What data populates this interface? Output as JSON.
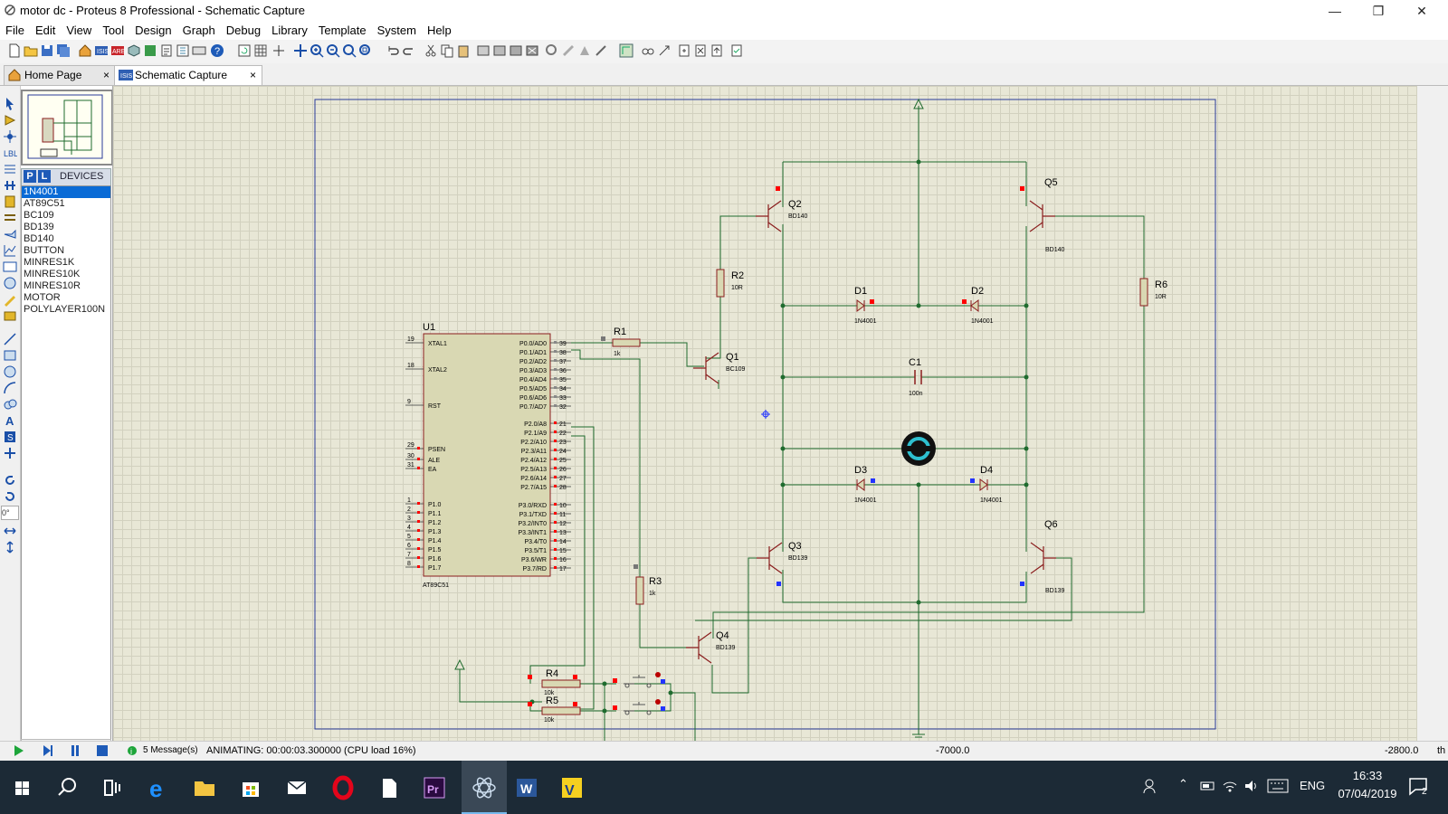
{
  "window": {
    "title": "motor dc - Proteus 8 Professional - Schematic Capture"
  },
  "menu": [
    "File",
    "Edit",
    "View",
    "Tool",
    "Design",
    "Graph",
    "Debug",
    "Library",
    "Template",
    "System",
    "Help"
  ],
  "tabs": [
    {
      "label": "Home Page",
      "close": "×"
    },
    {
      "label": "Schematic Capture",
      "close": "×"
    }
  ],
  "devices": {
    "header": "DEVICES",
    "p_button": "P",
    "l_button": "L",
    "items": [
      "1N4001",
      "AT89C51",
      "BC109",
      "BD139",
      "BD140",
      "BUTTON",
      "MINRES1K",
      "MINRES10K",
      "MINRES10R",
      "MOTOR",
      "POLYLAYER100N"
    ],
    "selected": "1N4001"
  },
  "rotation": "0°",
  "schematic": {
    "u1": {
      "ref": "U1",
      "part": "AT89C51",
      "left_pins": [
        {
          "num": "19",
          "name": "XTAL1"
        },
        {
          "num": "18",
          "name": "XTAL2"
        },
        {
          "num": "9",
          "name": "RST"
        },
        {
          "num": "29",
          "name": "PSEN"
        },
        {
          "num": "30",
          "name": "ALE"
        },
        {
          "num": "31",
          "name": "EA"
        },
        {
          "num": "1",
          "name": "P1.0"
        },
        {
          "num": "2",
          "name": "P1.1"
        },
        {
          "num": "3",
          "name": "P1.2"
        },
        {
          "num": "4",
          "name": "P1.3"
        },
        {
          "num": "5",
          "name": "P1.4"
        },
        {
          "num": "6",
          "name": "P1.5"
        },
        {
          "num": "7",
          "name": "P1.6"
        },
        {
          "num": "8",
          "name": "P1.7"
        }
      ],
      "right_pins": [
        {
          "num": "39",
          "name": "P0.0/AD0"
        },
        {
          "num": "38",
          "name": "P0.1/AD1"
        },
        {
          "num": "37",
          "name": "P0.2/AD2"
        },
        {
          "num": "36",
          "name": "P0.3/AD3"
        },
        {
          "num": "35",
          "name": "P0.4/AD4"
        },
        {
          "num": "34",
          "name": "P0.5/AD5"
        },
        {
          "num": "33",
          "name": "P0.6/AD6"
        },
        {
          "num": "32",
          "name": "P0.7/AD7"
        },
        {
          "num": "21",
          "name": "P2.0/A8"
        },
        {
          "num": "22",
          "name": "P2.1/A9"
        },
        {
          "num": "23",
          "name": "P2.2/A10"
        },
        {
          "num": "24",
          "name": "P2.3/A11"
        },
        {
          "num": "25",
          "name": "P2.4/A12"
        },
        {
          "num": "26",
          "name": "P2.5/A13"
        },
        {
          "num": "27",
          "name": "P2.6/A14"
        },
        {
          "num": "28",
          "name": "P2.7/A15"
        },
        {
          "num": "10",
          "name": "P3.0/RXD"
        },
        {
          "num": "11",
          "name": "P3.1/TXD"
        },
        {
          "num": "12",
          "name": "P3.2/INT0"
        },
        {
          "num": "13",
          "name": "P3.3/INT1"
        },
        {
          "num": "14",
          "name": "P3.4/T0"
        },
        {
          "num": "15",
          "name": "P3.5/T1"
        },
        {
          "num": "16",
          "name": "P3.6/WR"
        },
        {
          "num": "17",
          "name": "P3.7/RD"
        }
      ]
    },
    "components": {
      "r1": {
        "ref": "R1",
        "value": "1k"
      },
      "r2": {
        "ref": "R2",
        "value": "10R"
      },
      "r3": {
        "ref": "R3",
        "value": "1k"
      },
      "r4": {
        "ref": "R4",
        "value": "10k"
      },
      "r5": {
        "ref": "R5",
        "value": "10k"
      },
      "r6": {
        "ref": "R6",
        "value": "10R"
      },
      "q1": {
        "ref": "Q1",
        "value": "BC109"
      },
      "q2": {
        "ref": "Q2",
        "value": "BD140"
      },
      "q3": {
        "ref": "Q3",
        "value": "BD139"
      },
      "q4": {
        "ref": "Q4",
        "value": "BD139"
      },
      "q5": {
        "ref": "Q5",
        "value": "BD140"
      },
      "q6": {
        "ref": "Q6",
        "value": "BD139"
      },
      "d1": {
        "ref": "D1",
        "value": "1N4001"
      },
      "d2": {
        "ref": "D2",
        "value": "1N4001"
      },
      "d3": {
        "ref": "D3",
        "value": "1N4001"
      },
      "d4": {
        "ref": "D4",
        "value": "1N4001"
      },
      "c1": {
        "ref": "C1",
        "value": "100n"
      }
    }
  },
  "status": {
    "messages": "5 Message(s)",
    "animating": "ANIMATING: 00:00:03.300000 (CPU load 16%)",
    "coord_x": "-7000.0",
    "coord_y": "-2800.0",
    "unit": "th"
  },
  "taskbar": {
    "language": "ENG",
    "time": "16:33",
    "date": "07/04/2019",
    "notifications": "2"
  },
  "colors": {
    "accent": "#0a6bd6",
    "canvas": "#e8e7d6",
    "wire": "#1f6b2e",
    "pin_high": "#ff0000",
    "pin_low": "#2233ff",
    "taskbar": "#1c2a36"
  }
}
